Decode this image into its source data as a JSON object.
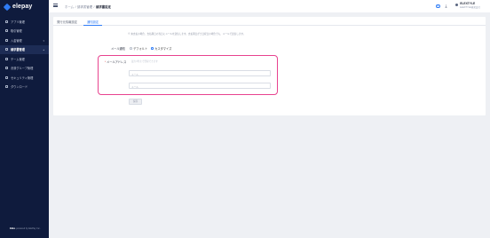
{
  "brand": {
    "name": "elepay"
  },
  "sidebar": {
    "items": [
      {
        "label": "アプリ管理",
        "icon": "app-icon",
        "active": false,
        "has_caret": false
      },
      {
        "label": "取引管理",
        "icon": "list-icon",
        "active": false,
        "has_caret": false
      },
      {
        "label": "入金管理",
        "icon": "bank-icon",
        "active": false,
        "has_caret": true
      },
      {
        "label": "請求書管理",
        "icon": "invoice-icon",
        "active": true,
        "has_caret": true
      },
      {
        "label": "チーム管理",
        "icon": "team-icon",
        "active": false,
        "has_caret": false
      },
      {
        "label": "決済グループ管理",
        "icon": "group-icon",
        "active": false,
        "has_caret": false
      },
      {
        "label": "セキュリティ管理",
        "icon": "shield-icon",
        "active": false,
        "has_caret": false
      },
      {
        "label": "ダウンロード",
        "icon": "download-icon",
        "active": false,
        "has_caret": false
      }
    ],
    "footer": {
      "brand": "Ekko",
      "text": "powered by ElePay Inc."
    }
  },
  "topbar": {
    "breadcrumb": [
      "ホーム",
      "請求書管理",
      "請求書設定"
    ],
    "user": {
      "name": "ELEXTYLE",
      "company": "ELEXTYLE株式会社"
    }
  },
  "tabs": [
    {
      "label": "発行元情報設定",
      "active": false
    },
    {
      "label": "通知設定",
      "active": true
    }
  ],
  "notice": "※ 未支払の場合、支払期日の当日にメールを送信します。支払期日が土日祝日の場合でも、メールで送信します。",
  "notification": {
    "label": "メール通知",
    "options": [
      {
        "label": "デフォルト",
        "checked": false
      },
      {
        "label": "カスタマイズ",
        "checked": true
      }
    ]
  },
  "email": {
    "label": "メールアドレス",
    "required": true,
    "hint": "最大3件まで登録できます",
    "fields": [
      {
        "value": "",
        "placeholder": "メール"
      },
      {
        "value": "",
        "placeholder": "メール"
      }
    ]
  },
  "save_label": "保存",
  "colors": {
    "accent": "#2f7cf6",
    "highlight": "#e8438f",
    "sidebar": "#0f1b3d"
  }
}
